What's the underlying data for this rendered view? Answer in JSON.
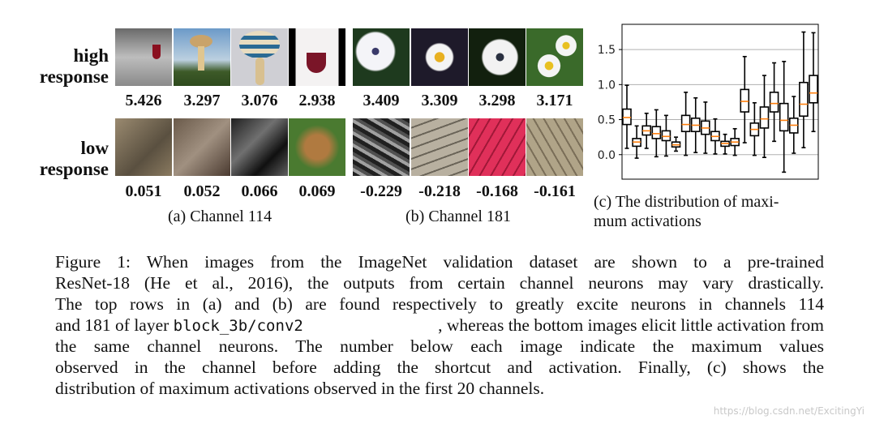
{
  "panel_a": {
    "row_labels": {
      "high": [
        "high",
        "response"
      ],
      "low": [
        "low",
        "response"
      ]
    },
    "high_values": [
      "5.426",
      "3.297",
      "3.076",
      "2.938"
    ],
    "low_values": [
      "0.051",
      "0.052",
      "0.066",
      "0.069"
    ],
    "caption": "(a) Channel 114"
  },
  "panel_b": {
    "high_values": [
      "3.409",
      "3.309",
      "3.298",
      "3.171"
    ],
    "low_values": [
      "-0.229",
      "-0.218",
      "-0.168",
      "-0.161"
    ],
    "caption": "(b) Channel 181"
  },
  "panel_c": {
    "caption_lines": [
      "(c) The distribution of maxi-",
      "mum activations"
    ]
  },
  "chart_data": {
    "type": "boxplot",
    "ylim": [
      -0.35,
      1.86
    ],
    "yticks": [
      0.0,
      0.5,
      1.0,
      1.5
    ],
    "ytick_labels": [
      "0.0",
      "0.5",
      "1.0",
      "1.5"
    ],
    "grid": "horizontal",
    "box_color": "#000000",
    "median_color": "#ff7f0e",
    "boxes": [
      {
        "whislo": 0.09,
        "q1": 0.43,
        "med": 0.53,
        "q3": 0.65,
        "whishi": 0.99
      },
      {
        "whislo": -0.05,
        "q1": 0.12,
        "med": 0.18,
        "q3": 0.23,
        "whishi": 0.41
      },
      {
        "whislo": 0.09,
        "q1": 0.28,
        "med": 0.34,
        "q3": 0.41,
        "whishi": 0.59
      },
      {
        "whislo": -0.03,
        "q1": 0.23,
        "med": 0.3,
        "q3": 0.4,
        "whishi": 0.64
      },
      {
        "whislo": -0.02,
        "q1": 0.2,
        "med": 0.26,
        "q3": 0.34,
        "whishi": 0.56
      },
      {
        "whislo": 0.05,
        "q1": 0.11,
        "med": 0.14,
        "q3": 0.18,
        "whishi": 0.25
      },
      {
        "whislo": -0.01,
        "q1": 0.33,
        "med": 0.43,
        "q3": 0.56,
        "whishi": 0.89
      },
      {
        "whislo": 0.03,
        "q1": 0.33,
        "med": 0.42,
        "q3": 0.52,
        "whishi": 0.81
      },
      {
        "whislo": 0.02,
        "q1": 0.29,
        "med": 0.38,
        "q3": 0.48,
        "whishi": 0.75
      },
      {
        "whislo": 0.01,
        "q1": 0.2,
        "med": 0.26,
        "q3": 0.33,
        "whishi": 0.51
      },
      {
        "whislo": 0.01,
        "q1": 0.12,
        "med": 0.16,
        "q3": 0.19,
        "whishi": 0.29
      },
      {
        "whislo": -0.01,
        "q1": 0.13,
        "med": 0.18,
        "q3": 0.23,
        "whishi": 0.37
      },
      {
        "whislo": 0.17,
        "q1": 0.61,
        "med": 0.76,
        "q3": 0.93,
        "whishi": 1.4
      },
      {
        "whislo": -0.01,
        "q1": 0.27,
        "med": 0.36,
        "q3": 0.45,
        "whishi": 0.74
      },
      {
        "whislo": -0.04,
        "q1": 0.38,
        "med": 0.51,
        "q3": 0.68,
        "whishi": 1.13
      },
      {
        "whislo": 0.19,
        "q1": 0.61,
        "med": 0.73,
        "q3": 0.89,
        "whishi": 1.31
      },
      {
        "whislo": -0.25,
        "q1": 0.34,
        "med": 0.49,
        "q3": 0.73,
        "whishi": 1.33
      },
      {
        "whislo": 0.02,
        "q1": 0.31,
        "med": 0.42,
        "q3": 0.52,
        "whishi": 0.83
      },
      {
        "whislo": 0.1,
        "q1": 0.55,
        "med": 0.72,
        "q3": 1.03,
        "whishi": 1.75
      },
      {
        "whislo": 0.33,
        "q1": 0.74,
        "med": 0.88,
        "q3": 1.13,
        "whishi": 1.74
      }
    ]
  },
  "figure_caption": {
    "line1": "Figure 1:  When images from the ImageNet validation dataset are shown to a pre-trained",
    "line2": "ResNet-18 (He et al., 2016), the outputs from certain channel neurons may vary drastically.",
    "line3": "The top rows in (a) and (b) are found respectively to greatly excite neurons in channels 114",
    "line4_pre": "and 181 of layer ",
    "line4_code": "block_3b/conv2",
    "line4_post": ", whereas the bottom images elicit little activation from",
    "line5": "the same channel neurons.  The number below each image indicate the maximum values",
    "line6": "observed in the channel before adding the shortcut and activation.  Finally, (c) shows the",
    "line7": "distribution of maximum activations observed in the first 20 channels."
  },
  "watermark": "https://blog.csdn.net/ExcitingYi"
}
